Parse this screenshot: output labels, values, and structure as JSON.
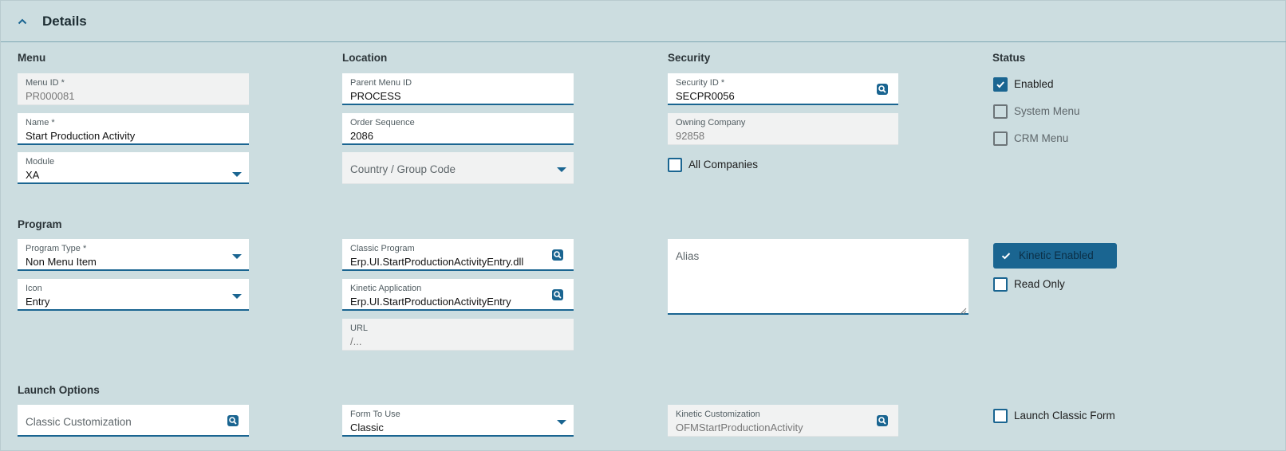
{
  "header": {
    "title": "Details"
  },
  "sections": {
    "menu": "Menu",
    "location": "Location",
    "security": "Security",
    "status": "Status",
    "program": "Program",
    "launch_options": "Launch Options"
  },
  "menu": {
    "menu_id": {
      "label": "Menu ID *",
      "value": "PR000081"
    },
    "name": {
      "label": "Name *",
      "value": "Start Production Activity"
    },
    "module": {
      "label": "Module",
      "value": "XA"
    }
  },
  "location": {
    "parent_menu_id": {
      "label": "Parent Menu ID",
      "value": "PROCESS"
    },
    "order_sequence": {
      "label": "Order Sequence",
      "value": "2086"
    },
    "country_group_code": {
      "placeholder": "Country / Group Code"
    }
  },
  "security": {
    "security_id": {
      "label": "Security ID *",
      "value": "SECPR0056"
    },
    "owning_company": {
      "label": "Owning Company",
      "value": "92858"
    },
    "all_companies": {
      "label": "All Companies",
      "checked": false
    }
  },
  "status": {
    "enabled": {
      "label": "Enabled",
      "checked": true
    },
    "system_menu": {
      "label": "System Menu",
      "checked": false
    },
    "crm_menu": {
      "label": "CRM Menu",
      "checked": false
    }
  },
  "program": {
    "program_type": {
      "label": "Program Type *",
      "value": "Non Menu Item"
    },
    "icon": {
      "label": "Icon",
      "value": "Entry"
    },
    "classic_program": {
      "label": "Classic Program",
      "value": "Erp.UI.StartProductionActivityEntry.dll"
    },
    "kinetic_application": {
      "label": "Kinetic Application",
      "value": "Erp.UI.StartProductionActivityEntry"
    },
    "url": {
      "label": "URL",
      "value": "/..."
    },
    "alias": {
      "placeholder": "Alias"
    },
    "kinetic_enabled": {
      "label": "Kinetic Enabled",
      "checked": true
    },
    "read_only": {
      "label": "Read Only",
      "checked": false
    }
  },
  "launch": {
    "classic_customization": {
      "placeholder": "Classic Customization"
    },
    "form_to_use": {
      "label": "Form To Use",
      "value": "Classic"
    },
    "kinetic_customization": {
      "label": "Kinetic Customization",
      "value": "OFMStartProductionActivity"
    },
    "launch_classic_form": {
      "label": "Launch Classic Form",
      "checked": false
    }
  },
  "colors": {
    "background": "#ccdde0",
    "accent": "#1a6591",
    "field_bg": "#ffffff",
    "readonly_bg": "#f1f2f2"
  },
  "icons": {
    "collapse": "chevron-up-icon",
    "lookup": "search-lookup-icon",
    "dropdown": "caret-down-icon",
    "check": "checkmark-icon"
  }
}
